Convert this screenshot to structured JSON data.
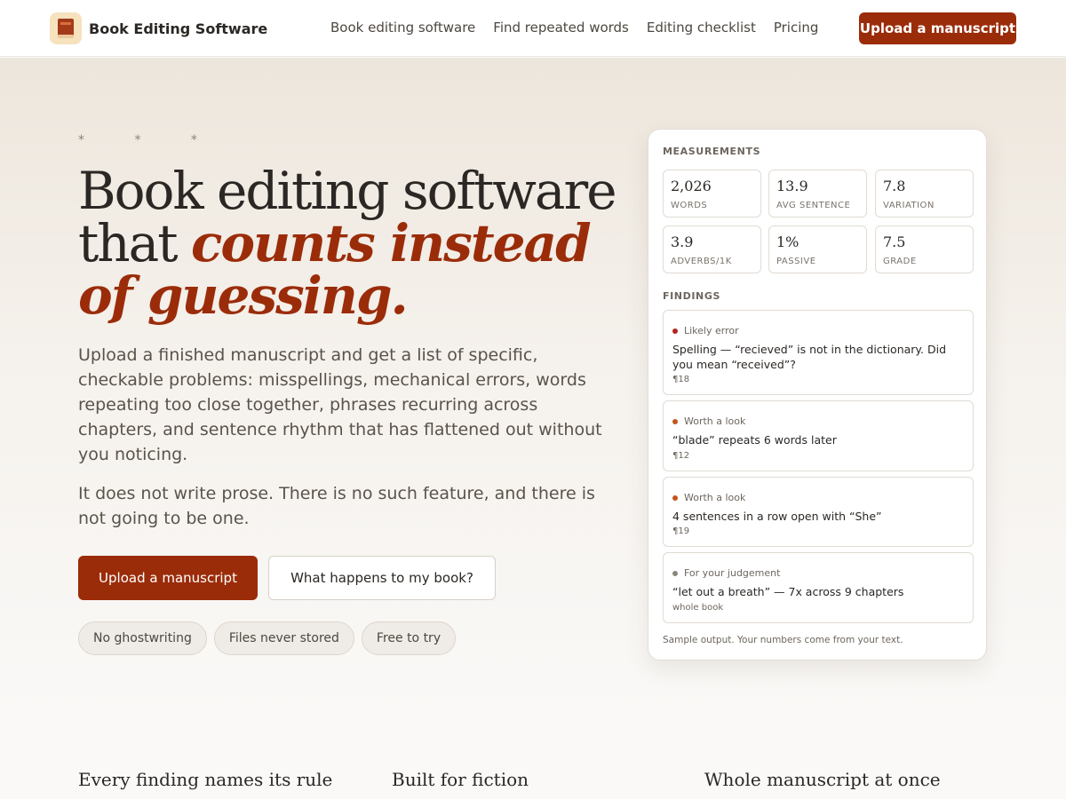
{
  "header": {
    "brand_name": "Book Editing Software",
    "nav": [
      "Book editing software",
      "Find repeated words",
      "Editing checklist",
      "Pricing"
    ],
    "cta": "Upload a manuscript"
  },
  "hero": {
    "ornament": "* * *",
    "title_plain": "Book editing software that ",
    "title_emphasis": "counts instead of guessing.",
    "paragraph_1": "Upload a finished manuscript and get a list of specific, checkable problems: misspellings, mechanical errors, words repeating too close together, phrases recurring across chapters, and sentence rhythm that has flattened out without you noticing.",
    "paragraph_2": "It does not write prose. There is no such feature, and there is not going to be one.",
    "primary_button": "Upload a manuscript",
    "secondary_button": "What happens to my book?",
    "badges": [
      "No ghostwriting",
      "Files never stored",
      "Free to try"
    ]
  },
  "sample": {
    "measurements_label": "MEASUREMENTS",
    "metrics": [
      {
        "value": "2,026",
        "label": "WORDS"
      },
      {
        "value": "13.9",
        "label": "AVG SENTENCE"
      },
      {
        "value": "7.8",
        "label": "VARIATION"
      },
      {
        "value": "3.9",
        "label": "ADVERBS/1K"
      },
      {
        "value": "1%",
        "label": "PASSIVE"
      },
      {
        "value": "7.5",
        "label": "GRADE"
      }
    ],
    "findings_label": "FINDINGS",
    "findings": [
      {
        "severity": "Likely error",
        "color": "#b3261e",
        "text": "Spelling — “recieved” is not in the dictionary. Did you mean “received”?",
        "location": "¶18"
      },
      {
        "severity": "Worth a look",
        "color": "#c0561d",
        "text": "“blade” repeats 6 words later",
        "location": "¶12"
      },
      {
        "severity": "Worth a look",
        "color": "#c0561d",
        "text": "4 sentences in a row open with “She”",
        "location": "¶19"
      },
      {
        "severity": "For your judgement",
        "color": "#8d867e",
        "text": "“let out a breath” — 7x across 9 chapters",
        "location": "whole book"
      }
    ],
    "footnote": "Sample output. Your numbers come from your text."
  },
  "features": [
    "Every finding names its rule",
    "Built for fiction",
    "Whole manuscript at once"
  ],
  "colors": {
    "accent": "#9b2c0a",
    "brand_logo_bg": "#f6e2bd"
  }
}
